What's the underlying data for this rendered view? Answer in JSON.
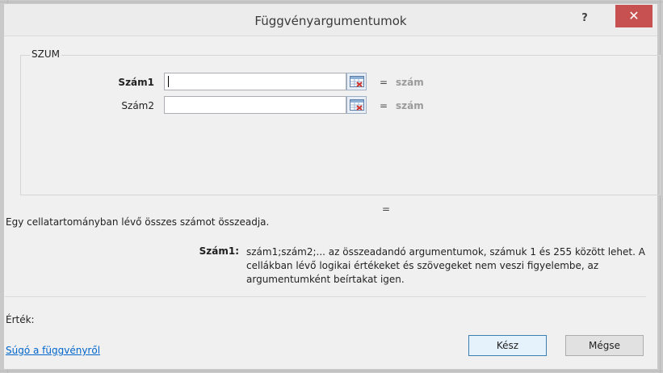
{
  "dialog": {
    "title": "Függvényargumentumok",
    "help_symbol": "?",
    "close_symbol": "✕"
  },
  "function_group": {
    "name": "SZUM",
    "args": [
      {
        "label": "Szám1",
        "value": "",
        "eq": "=",
        "result": "szám"
      },
      {
        "label": "Szám2",
        "value": "",
        "eq": "=",
        "result": "szám"
      }
    ]
  },
  "formula_result_eq": "=",
  "description": "Egy cellatartományban lévő összes számot összeadja.",
  "arg_description": {
    "name": "Szám1:",
    "text": "szám1;szám2;... az összeadandó argumentumok, számuk 1 és 255 között lehet. A cellákban lévő logikai értékeket és szövegeket nem veszi figyelembe, az argumentumként beírtakat igen."
  },
  "value_label": "Érték:",
  "help_link": "Súgó a függvényről",
  "buttons": {
    "ok": "Kész",
    "cancel": "Mégse"
  },
  "colors": {
    "close_bg": "#c75050",
    "link": "#0066cc",
    "dialog_bg": "#f0f0f0"
  },
  "icons": {
    "ref": "range-selector-icon"
  }
}
